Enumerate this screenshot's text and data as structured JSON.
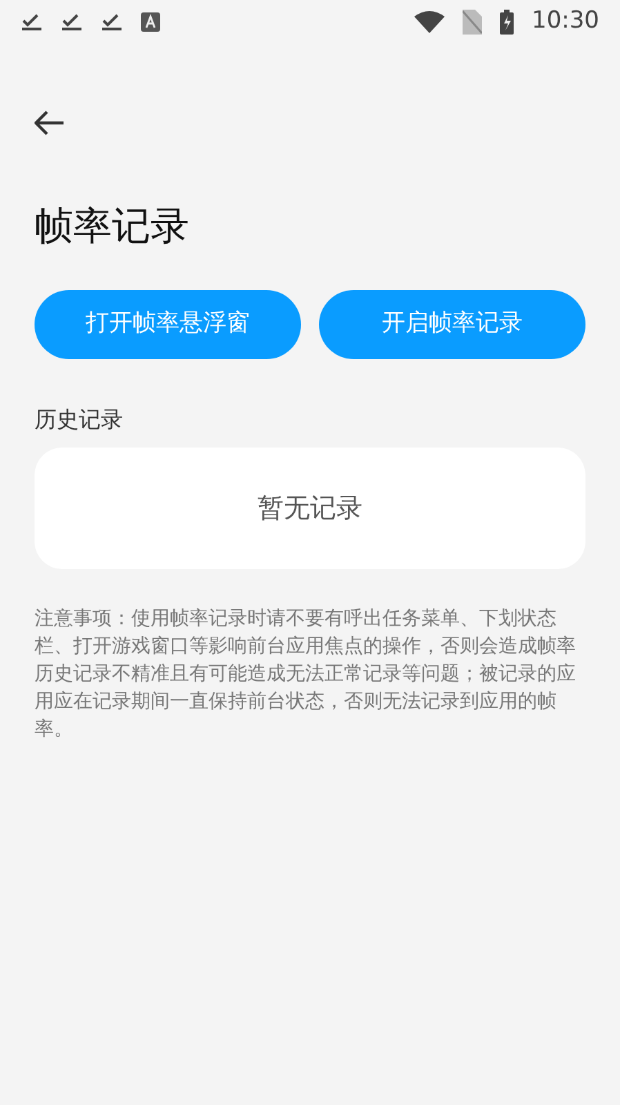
{
  "status_bar": {
    "time": "10:30"
  },
  "title": "帧率记录",
  "buttons": [
    {
      "label": "打开帧率悬浮窗"
    },
    {
      "label": "开启帧率记录"
    }
  ],
  "history": {
    "heading": "历史记录",
    "empty_text": "暂无记录"
  },
  "notice": "注意事项：使用帧率记录时请不要有呼出任务菜单、下划状态栏、打开游戏窗口等影响前台应用焦点的操作，否则会造成帧率历史记录不精准且有可能造成无法正常记录等问题；被记录的应用应在记录期间一直保持前台状态，否则无法记录到应用的帧率。"
}
